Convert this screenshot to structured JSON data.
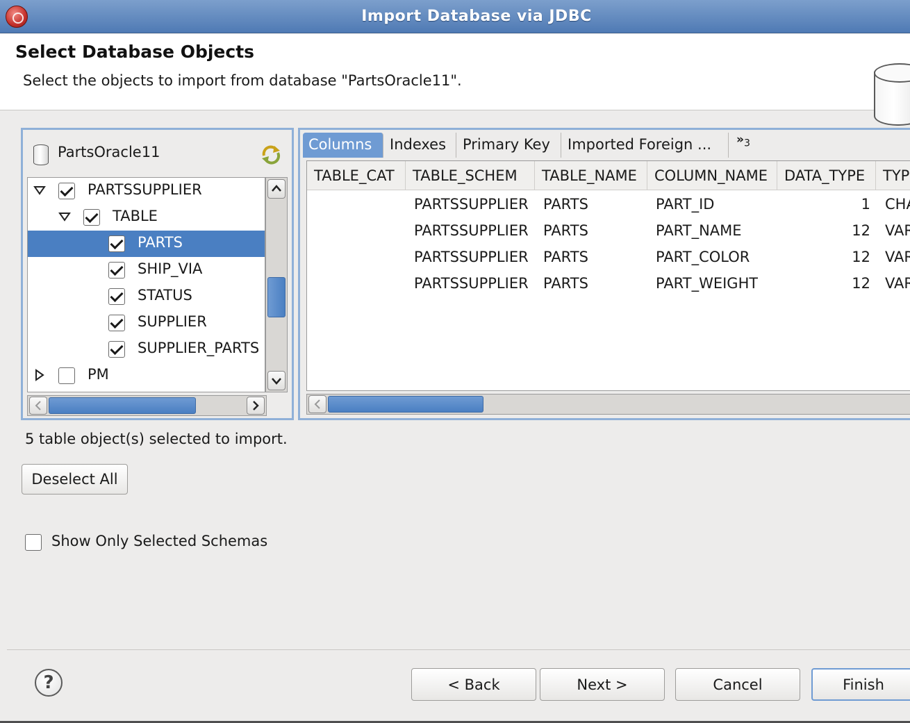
{
  "window": {
    "title": "Import Database via JDBC"
  },
  "header": {
    "title": "Select Database Objects",
    "description": "Select the objects to import from database \"PartsOracle11\"."
  },
  "tree": {
    "connection_label": "PartsOracle11",
    "items": [
      {
        "label": "PARTSSUPPLIER",
        "level": 0,
        "expanded": true,
        "checked": true,
        "selected": false
      },
      {
        "label": "TABLE",
        "level": 1,
        "expanded": true,
        "checked": true,
        "selected": false
      },
      {
        "label": "PARTS",
        "level": 2,
        "checked": true,
        "selected": true
      },
      {
        "label": "SHIP_VIA",
        "level": 2,
        "checked": true,
        "selected": false
      },
      {
        "label": "STATUS",
        "level": 2,
        "checked": true,
        "selected": false
      },
      {
        "label": "SUPPLIER",
        "level": 2,
        "checked": true,
        "selected": false
      },
      {
        "label": "SUPPLIER_PARTS",
        "level": 2,
        "checked": true,
        "selected": false
      },
      {
        "label": "PM",
        "level": 0,
        "expanded": false,
        "checked": false,
        "selected": false
      }
    ]
  },
  "tabs": {
    "items": [
      "Columns",
      "Indexes",
      "Primary Key",
      "Imported Foreign ..."
    ],
    "active": "Columns",
    "overflow_label": "»",
    "overflow_count": "3"
  },
  "table": {
    "columns": [
      "TABLE_CAT",
      "TABLE_SCHEM",
      "TABLE_NAME",
      "COLUMN_NAME",
      "DATA_TYPE",
      "TYP"
    ],
    "rows": [
      [
        "",
        "PARTSSUPPLIER",
        "PARTS",
        "PART_ID",
        "1",
        "CHA"
      ],
      [
        "",
        "PARTSSUPPLIER",
        "PARTS",
        "PART_NAME",
        "12",
        "VAR"
      ],
      [
        "",
        "PARTSSUPPLIER",
        "PARTS",
        "PART_COLOR",
        "12",
        "VAR"
      ],
      [
        "",
        "PARTSSUPPLIER",
        "PARTS",
        "PART_WEIGHT",
        "12",
        "VAR"
      ]
    ]
  },
  "status_text": "5 table object(s) selected to import.",
  "buttons": {
    "deselect_all": "Deselect All",
    "back": "< Back",
    "next": "Next >",
    "cancel": "Cancel",
    "finish": "Finish"
  },
  "options": {
    "show_only_selected_schemas": "Show Only Selected Schemas",
    "show_only_selected_checked": false
  },
  "colors": {
    "accent": "#4a7fc2",
    "titlebar": "#5b86bf",
    "panel_border": "#8fb0d8"
  }
}
